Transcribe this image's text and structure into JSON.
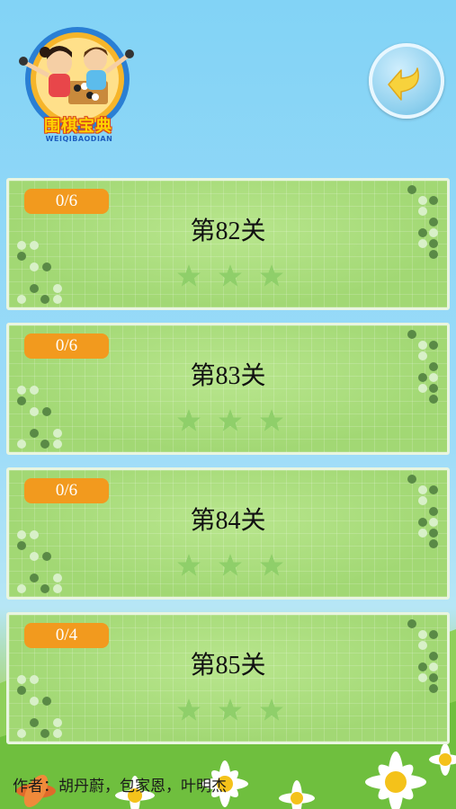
{
  "logo": {
    "title": "围棋宝典",
    "subtitle": "WEIQIBAODIAN"
  },
  "back_button": {
    "icon": "back-arrow-icon"
  },
  "levels": [
    {
      "progress": "0/6",
      "title": "第82关",
      "stars_earned": 0,
      "stars_total": 3
    },
    {
      "progress": "0/6",
      "title": "第83关",
      "stars_earned": 0,
      "stars_total": 3
    },
    {
      "progress": "0/6",
      "title": "第84关",
      "stars_earned": 0,
      "stars_total": 3
    },
    {
      "progress": "0/4",
      "title": "第85关",
      "stars_earned": 0,
      "stars_total": 3
    }
  ],
  "footer": {
    "author": "作者：胡丹蔚，包家恩，叶明杰"
  },
  "colors": {
    "sky": "#82d3f6",
    "card": "#a6dc78",
    "badge": "#f29a1e",
    "star": "#8fcf6a"
  }
}
